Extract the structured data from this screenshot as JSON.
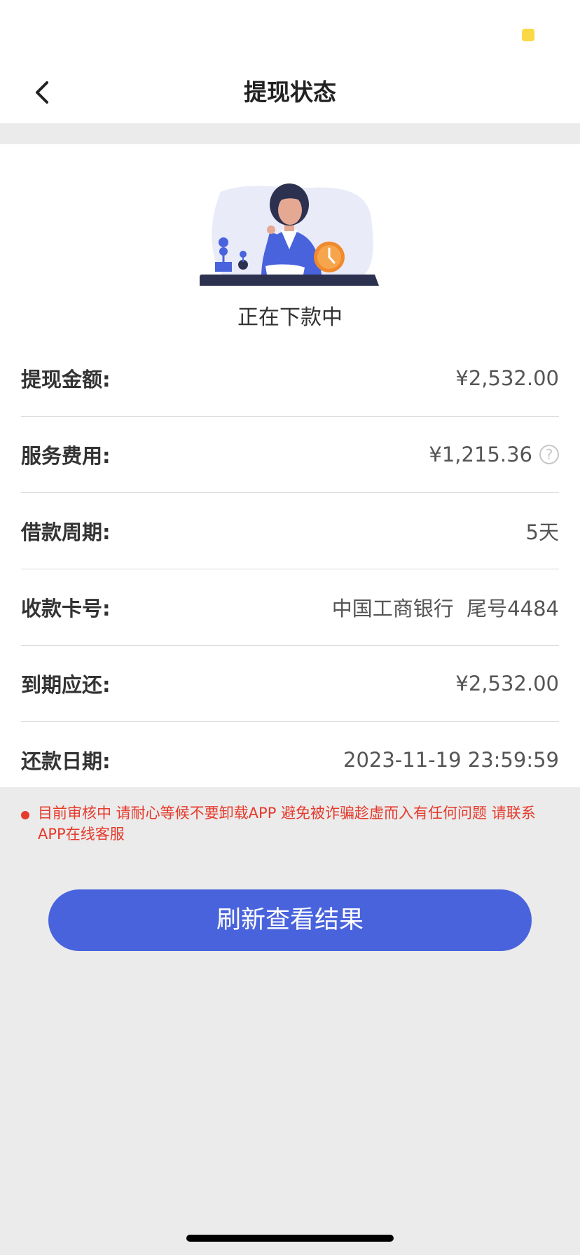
{
  "colors": {
    "accent": "#4963dd",
    "warning": "#e53a2c",
    "status_dot": "#fbd847"
  },
  "header": {
    "title": "提现状态",
    "back_icon": "chevron-left-icon"
  },
  "status": {
    "text": "正在下款中",
    "illustration": "woman-waiting-clock"
  },
  "details": [
    {
      "label": "提现金额:",
      "value": "¥2,532.00"
    },
    {
      "label": "服务费用:",
      "value": "¥1,215.36",
      "help_icon": "?"
    },
    {
      "label": "借款周期:",
      "value": "5天"
    },
    {
      "label": "收款卡号:",
      "value": "中国工商银行  尾号4484"
    },
    {
      "label": "到期应还:",
      "value": "¥2,532.00"
    },
    {
      "label": "还款日期:",
      "value": "2023-11-19 23:59:59"
    }
  ],
  "notice": {
    "text": "目前审核中 请耐心等候不要卸载APP 避免被诈骗趁虚而入有任何问题 请联系APP在线客服"
  },
  "actions": {
    "refresh_label": "刷新查看结果"
  }
}
